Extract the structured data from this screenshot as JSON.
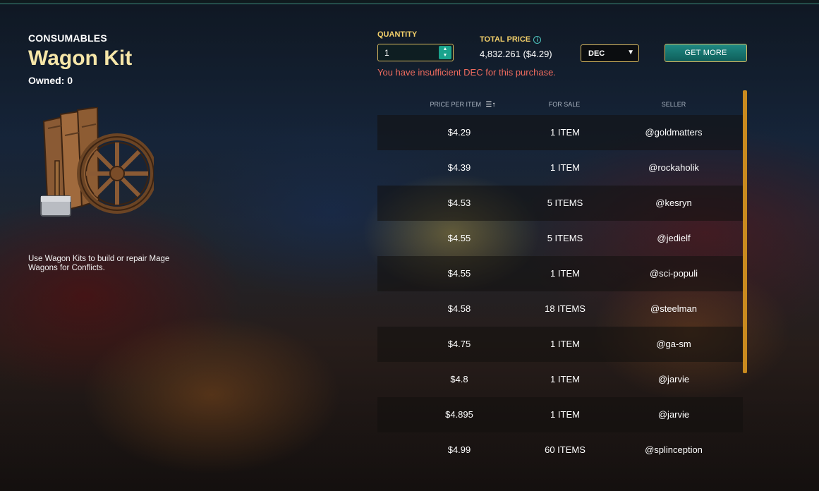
{
  "item": {
    "category": "CONSUMABLES",
    "name": "Wagon Kit",
    "owned": "Owned: 0",
    "description": "Use Wagon Kits to build or repair Mage Wagons for Conflicts.",
    "art_icon": "wagon-kit-icon"
  },
  "purchase": {
    "quantity_label": "QUANTITY",
    "quantity_value": "1",
    "total_label": "TOTAL PRICE",
    "total_value": "4,832.261 ($4.29)",
    "warning": "You have insufficient DEC for this purchase.",
    "currency_selected": "DEC",
    "get_more_label": "GET MORE"
  },
  "table": {
    "headers": {
      "price": "PRICE PER ITEM",
      "for_sale": "FOR SALE",
      "seller": "SELLER"
    },
    "rows": [
      {
        "price": "$4.29",
        "for_sale": "1 ITEM",
        "seller": "@goldmatters"
      },
      {
        "price": "$4.39",
        "for_sale": "1 ITEM",
        "seller": "@rockaholik"
      },
      {
        "price": "$4.53",
        "for_sale": "5 ITEMS",
        "seller": "@kesryn"
      },
      {
        "price": "$4.55",
        "for_sale": "5 ITEMS",
        "seller": "@jedielf"
      },
      {
        "price": "$4.55",
        "for_sale": "1 ITEM",
        "seller": "@sci-populi"
      },
      {
        "price": "$4.58",
        "for_sale": "18 ITEMS",
        "seller": "@steelman"
      },
      {
        "price": "$4.75",
        "for_sale": "1 ITEM",
        "seller": "@ga-sm"
      },
      {
        "price": "$4.8",
        "for_sale": "1 ITEM",
        "seller": "@jarvie"
      },
      {
        "price": "$4.895",
        "for_sale": "1 ITEM",
        "seller": "@jarvie"
      },
      {
        "price": "$4.99",
        "for_sale": "60 ITEMS",
        "seller": "@splinception"
      }
    ]
  },
  "colors": {
    "accent_gold": "#f2cf6a",
    "title_cream": "#f6e6a8",
    "warning_red": "#ee6b5e",
    "button_teal": "#1f8a84",
    "scrollbar": "#c98a1f"
  }
}
